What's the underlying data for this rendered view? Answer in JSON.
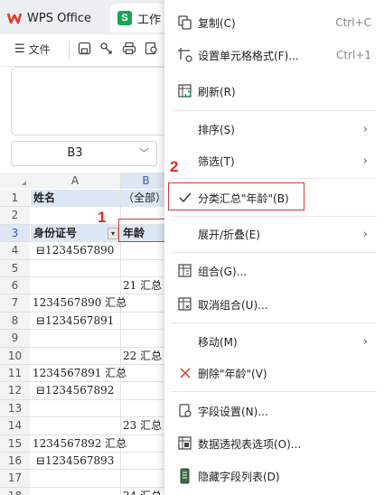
{
  "tabs": [
    {
      "label": "WPS Office"
    },
    {
      "label": "工作"
    }
  ],
  "toolbar": {
    "file_label": "文件"
  },
  "namebox": {
    "value": "B3"
  },
  "columns": [
    "A",
    "B"
  ],
  "rows": [
    {
      "num": "1",
      "a": "姓名",
      "b": "（全部）"
    },
    {
      "num": "2",
      "a": "",
      "b": ""
    },
    {
      "num": "3",
      "a": "身份证号",
      "b": "年龄"
    },
    {
      "num": "4",
      "a": "⊟1234567890",
      "b": ""
    },
    {
      "num": "5",
      "a": "",
      "b": ""
    },
    {
      "num": "6",
      "a": "",
      "b": "21 汇总"
    },
    {
      "num": "7",
      "a": "1234567890 汇总",
      "b": ""
    },
    {
      "num": "8",
      "a": "⊟1234567891",
      "b": ""
    },
    {
      "num": "9",
      "a": "",
      "b": ""
    },
    {
      "num": "10",
      "a": "",
      "b": "22 汇总"
    },
    {
      "num": "11",
      "a": "1234567891 汇总",
      "b": ""
    },
    {
      "num": "12",
      "a": "⊟1234567892",
      "b": ""
    },
    {
      "num": "13",
      "a": "",
      "b": ""
    },
    {
      "num": "14",
      "a": "",
      "b": "23 汇总"
    },
    {
      "num": "15",
      "a": "1234567892 汇总",
      "b": ""
    },
    {
      "num": "16",
      "a": "⊟1234567893",
      "b": ""
    },
    {
      "num": "17",
      "a": "",
      "b": ""
    },
    {
      "num": "18",
      "a": "",
      "b": "24 汇总"
    }
  ],
  "menu": {
    "copy": {
      "label": "复制(C)",
      "shortcut": "Ctrl+C"
    },
    "format_cells": {
      "label": "设置单元格格式(F)...",
      "shortcut": "Ctrl+1"
    },
    "refresh": {
      "label": "刷新(R)"
    },
    "sort": {
      "label": "排序(S)"
    },
    "filter": {
      "label": "筛选(T)"
    },
    "subtotal": {
      "label": "分类汇总\"年龄\"(B)"
    },
    "expand": {
      "label": "展开/折叠(E)"
    },
    "group": {
      "label": "组合(G)..."
    },
    "ungroup": {
      "label": "取消组合(U)..."
    },
    "move": {
      "label": "移动(M)"
    },
    "delete": {
      "label": "删除\"年龄\"(V)"
    },
    "field_settings": {
      "label": "字段设置(N)..."
    },
    "pivot_options": {
      "label": "数据透视表选项(O)..."
    },
    "hide_field_list": {
      "label": "隐藏字段列表(D)"
    }
  },
  "annotations": {
    "step1": "1",
    "step2": "2"
  },
  "colors": {
    "accent_red": "#d23a3a",
    "wps_red": "#e03a2f",
    "sheet_green": "#1aa45b",
    "header_blue": "#dde6f4"
  }
}
